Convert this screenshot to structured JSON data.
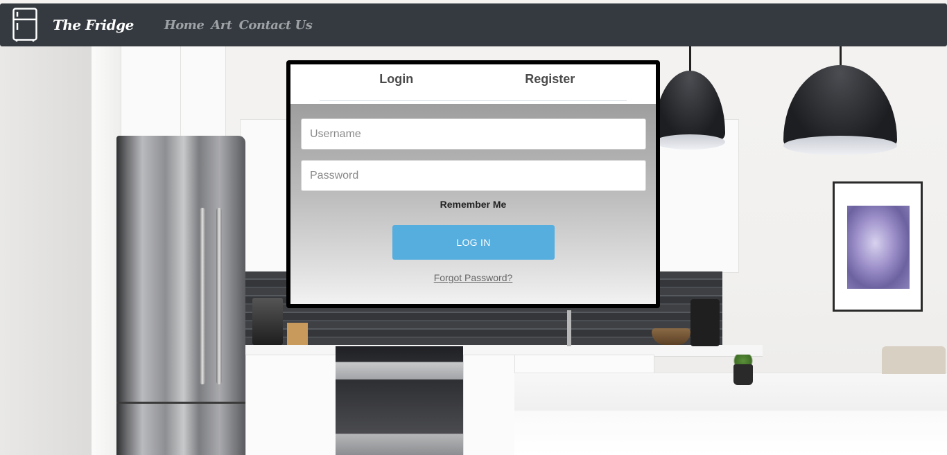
{
  "nav": {
    "brand": "The Fridge",
    "brand_icon": "fridge-icon",
    "links": [
      {
        "label": "Home"
      },
      {
        "label": "Art"
      },
      {
        "label": "Contact Us"
      }
    ],
    "background_color": "#343a40"
  },
  "modal": {
    "tabs": [
      {
        "label": "Login"
      },
      {
        "label": "Register"
      }
    ],
    "username": {
      "placeholder": "Username",
      "value": ""
    },
    "password": {
      "placeholder": "Password",
      "value": ""
    },
    "remember_label": "Remember Me",
    "login_button_label": "LOG IN",
    "forgot_link": "Forgot Password?",
    "button_color": "#56aedf"
  }
}
